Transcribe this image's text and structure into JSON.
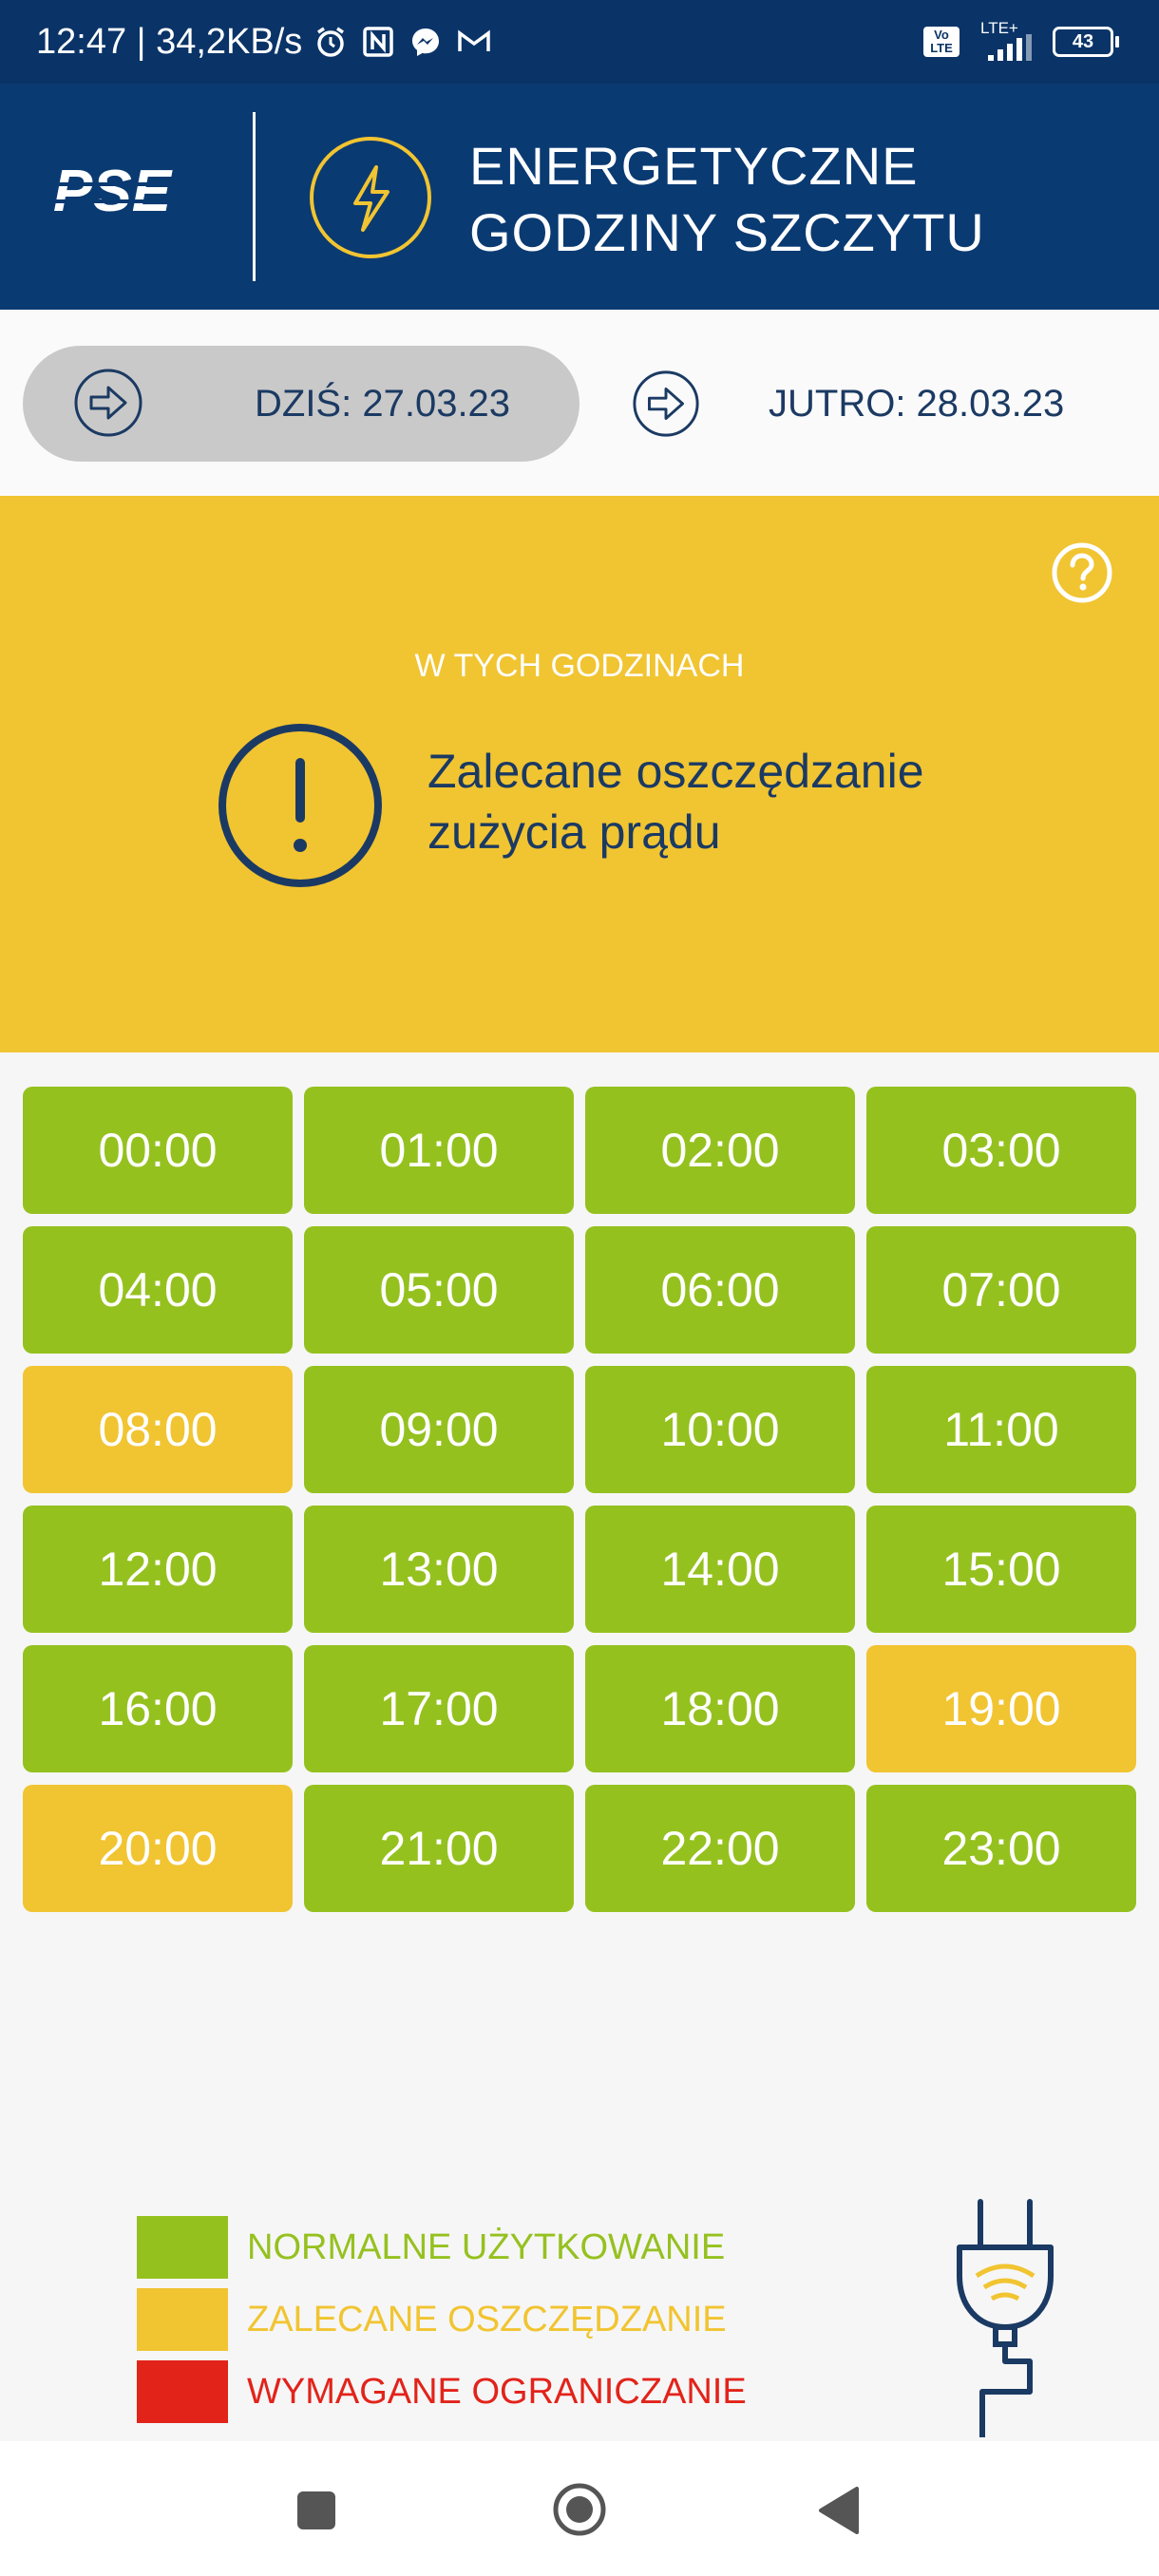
{
  "status_bar": {
    "time_speed": "12:47 | 34,2KB/s",
    "volte": "Vo LTE",
    "network": "LTE+",
    "battery": "43"
  },
  "header": {
    "logo_text": "PSE",
    "title_line1": "ENERGETYCZNE",
    "title_line2": "GODZINY SZCZYTU"
  },
  "days": {
    "today_label": "DZIŚ: 27.03.23",
    "tomorrow_label": "JUTRO: 28.03.23"
  },
  "banner": {
    "subheading": "W TYCH GODZINACH",
    "message": "Zalecane oszczędzanie zużycia prądu",
    "help_icon": "question-circle-icon",
    "alert_icon": "exclamation-circle-icon"
  },
  "colors": {
    "normal": "#95c11f",
    "saving": "#f1c431",
    "required": "#e2231a",
    "header_blue": "#0a3a72",
    "text_blue": "#1b3a63"
  },
  "hours": [
    {
      "label": "00:00",
      "status": "normal"
    },
    {
      "label": "01:00",
      "status": "normal"
    },
    {
      "label": "02:00",
      "status": "normal"
    },
    {
      "label": "03:00",
      "status": "normal"
    },
    {
      "label": "04:00",
      "status": "normal"
    },
    {
      "label": "05:00",
      "status": "normal"
    },
    {
      "label": "06:00",
      "status": "normal"
    },
    {
      "label": "07:00",
      "status": "normal"
    },
    {
      "label": "08:00",
      "status": "saving"
    },
    {
      "label": "09:00",
      "status": "normal"
    },
    {
      "label": "10:00",
      "status": "normal"
    },
    {
      "label": "11:00",
      "status": "normal"
    },
    {
      "label": "12:00",
      "status": "normal"
    },
    {
      "label": "13:00",
      "status": "normal"
    },
    {
      "label": "14:00",
      "status": "normal"
    },
    {
      "label": "15:00",
      "status": "normal"
    },
    {
      "label": "16:00",
      "status": "normal"
    },
    {
      "label": "17:00",
      "status": "normal"
    },
    {
      "label": "18:00",
      "status": "normal"
    },
    {
      "label": "19:00",
      "status": "saving"
    },
    {
      "label": "20:00",
      "status": "saving"
    },
    {
      "label": "21:00",
      "status": "normal"
    },
    {
      "label": "22:00",
      "status": "normal"
    },
    {
      "label": "23:00",
      "status": "normal"
    }
  ],
  "legend": [
    {
      "label": "NORMALNE UŻYTKOWANIE",
      "status": "normal"
    },
    {
      "label": "ZALECANE OSZCZĘDZANIE",
      "status": "saving"
    },
    {
      "label": "WYMAGANE OGRANICZANIE",
      "status": "required"
    }
  ]
}
